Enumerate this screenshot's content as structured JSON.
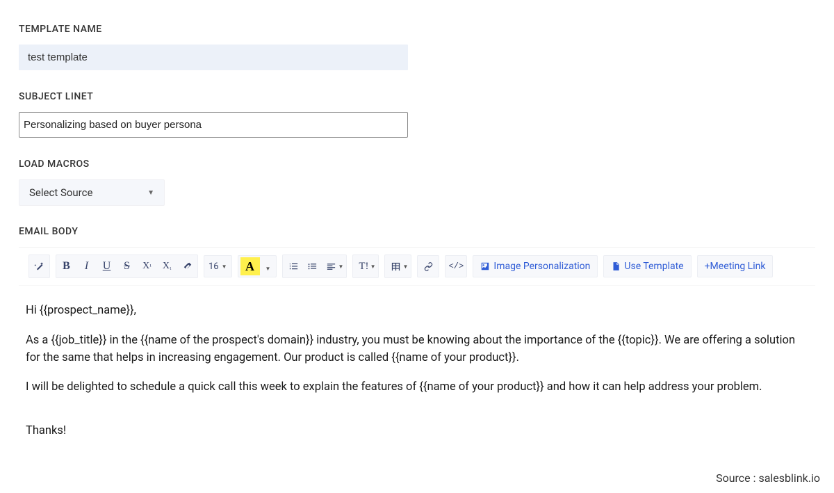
{
  "labels": {
    "template_name": "TEMPLATE NAME",
    "subject_line": "SUBJECT LINET",
    "load_macros": "LOAD MACROS",
    "email_body": "EMAIL BODY"
  },
  "fields": {
    "template_name_value": "test template",
    "subject_line_value": "Personalizing based on buyer persona",
    "macro_source_selected": "Select Source"
  },
  "toolbar": {
    "bold": "B",
    "italic": "I",
    "underline": "U",
    "strike": "S",
    "superscript": "X",
    "subscript": "X",
    "font_size": "16",
    "font_color_glyph": "A",
    "paragraph_style": "T!",
    "code": "</>",
    "image_personalization": "Image Personalization",
    "use_template": "Use Template",
    "meeting_link": "+Meeting Link"
  },
  "email_body": {
    "greeting": "Hi {{prospect_name}},",
    "para1": "As a {{job_title}} in the {{name of the prospect's domain}} industry, you must be knowing about the importance of the {{topic}}. We are offering a solution for the same that helps in increasing engagement. Our product is called {{name of your product}}.",
    "para2": "I will be delighted to schedule a quick call this week to explain the features of {{name of your product}} and how it can help address your problem.",
    "closing": "Thanks!"
  },
  "footer": {
    "source": "Source : salesblink.io"
  }
}
